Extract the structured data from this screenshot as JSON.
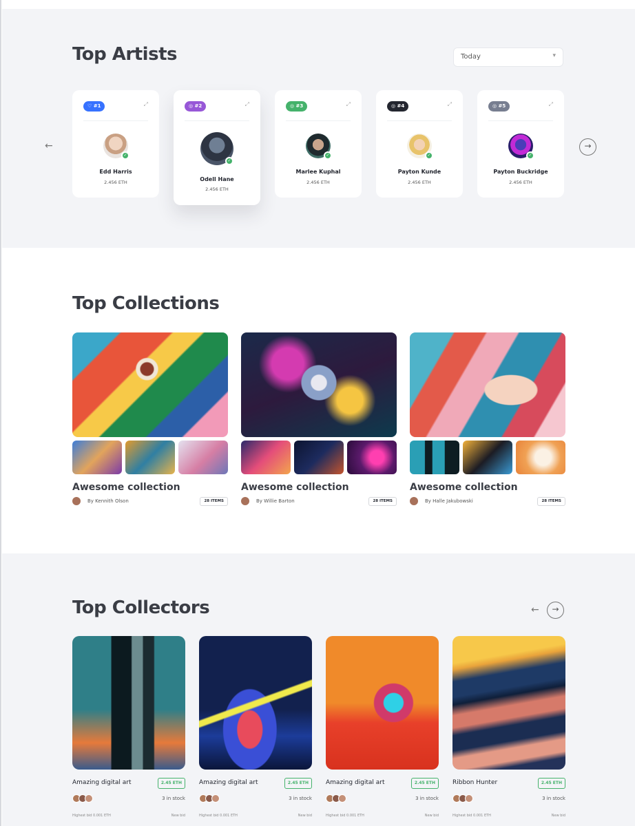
{
  "top_artists": {
    "title": "Top Artists",
    "filter_value": "Today",
    "artists": [
      {
        "rank": "#1",
        "name": "Edd Harris",
        "amount": "2.456 ETH",
        "rank_color": "#3772ff"
      },
      {
        "rank": "#2",
        "name": "Odell Hane",
        "amount": "2.456 ETH",
        "rank_color": "#9757d7"
      },
      {
        "rank": "#3",
        "name": "Marlee Kuphal",
        "amount": "2.456 ETH",
        "rank_color": "#45b26b"
      },
      {
        "rank": "#4",
        "name": "Payton Kunde",
        "amount": "2.456 ETH",
        "rank_color": "#23262f"
      },
      {
        "rank": "#5",
        "name": "Payton Buckridge",
        "amount": "2.456 ETH",
        "rank_color": "#777e90"
      }
    ]
  },
  "top_collections": {
    "title": "Top Collections",
    "collections": [
      {
        "title": "Awesome collection",
        "author": "By Kennith Olson",
        "items": "28 ITEMS"
      },
      {
        "title": "Awesome collection",
        "author": "By Willie Barton",
        "items": "28 ITEMS"
      },
      {
        "title": "Awesome collection",
        "author": "By Halle Jakubowski",
        "items": "28 ITEMS"
      }
    ]
  },
  "top_collectors": {
    "title": "Top Collectors",
    "items": [
      {
        "title": "Amazing digital art",
        "price": "2.45 ETH",
        "stock": "3 in stock",
        "bid": "Highest bid 0.001 ETH",
        "new_bid": "New bid"
      },
      {
        "title": "Amazing digital art",
        "price": "2.45 ETH",
        "stock": "3 in stock",
        "bid": "Highest bid 0.001 ETH",
        "new_bid": "New bid"
      },
      {
        "title": "Amazing digital art",
        "price": "2.45 ETH",
        "stock": "3 in stock",
        "bid": "Highest bid 0.001 ETH",
        "new_bid": "New bid"
      },
      {
        "title": "Ribbon Hunter",
        "price": "2.45 ETH",
        "stock": "3 in stock",
        "bid": "Highest bid 0.001 ETH",
        "new_bid": "New bid"
      }
    ]
  },
  "colors": {
    "accent_green": "#45b26b",
    "section_background": "#f3f4f7"
  },
  "icons": {
    "prev": "arrow-left-icon",
    "next": "arrow-right-circle-icon",
    "rank": "badge-icon",
    "pin": "pin-icon",
    "verified": "check-icon",
    "dropdown": "chevron-down-icon"
  }
}
